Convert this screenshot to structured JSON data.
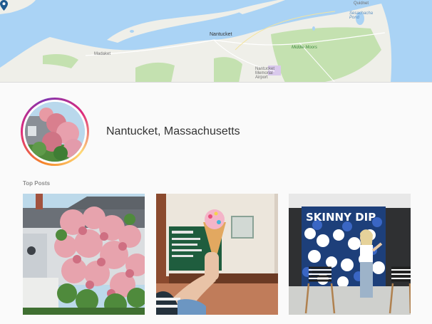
{
  "map": {
    "labels": {
      "town": "Nantucket",
      "madaket": "Madaket",
      "middle_moors": "Middle Moors",
      "quidnet": "Quidnet",
      "sesachacha": "Sesachacha Pond",
      "airport": "Nantucket Memorial Airport"
    },
    "colors": {
      "water": "#aad3f5",
      "land": "#efefe9",
      "park": "#c4e1b0",
      "pin": "#1f5a8f"
    }
  },
  "location": {
    "title": "Nantucket, Massachusetts"
  },
  "top_posts": {
    "label": "Top Posts",
    "posts": [
      {
        "alt_icon": "rose-cottage-photo"
      },
      {
        "alt_icon": "ice-cream-cone-photo"
      },
      {
        "alt_icon": "flower-wall-photo"
      }
    ]
  },
  "sign_text": "SKINNY DIP"
}
